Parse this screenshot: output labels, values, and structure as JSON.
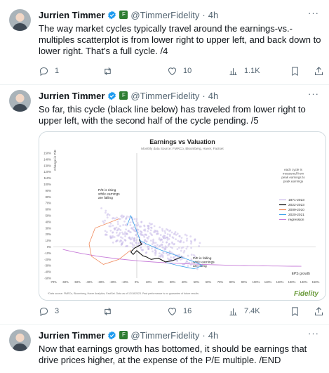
{
  "tweets": [
    {
      "author": "Jurrien Timmer",
      "handle": "@TimmerFidelity",
      "dot": "·",
      "time": "4h",
      "text": "The way market cycles typically travel around the earnings-vs.-multiples scatterplot is from lower right to upper left, and back down to lower right. That's a full cycle. /4",
      "replies": "1",
      "reposts": "",
      "likes": "10",
      "views": "1.1K"
    },
    {
      "author": "Jurrien Timmer",
      "handle": "@TimmerFidelity",
      "dot": "·",
      "time": "4h",
      "text": "So far, this cycle (black line below) has traveled from lower right to upper left, with the second half of the cycle pending. /5",
      "replies": "3",
      "reposts": "",
      "likes": "16",
      "views": "7.4K"
    },
    {
      "author": "Jurrien Timmer",
      "handle": "@TimmerFidelity",
      "dot": "·",
      "time": "4h",
      "text": "Now that earnings growth has bottomed, it should be earnings that drive prices higher, at the expense of the P/E multiple. /END"
    }
  ],
  "chart_data": {
    "type": "scatter",
    "title": "Earnings vs Valuation",
    "subtitle": "Monthly data   Source: FMRCo, Bloomberg, Haver, Factset",
    "ylabel": "Change in P/E",
    "xlabel": "EPS growth",
    "xlim": [
      -70,
      150
    ],
    "ylim": [
      -50,
      100
    ],
    "x_ticks": [
      "-70%",
      "-60%",
      "-50%",
      "-40%",
      "-30%",
      "-20%",
      "-10%",
      "0%",
      "10%",
      "20%",
      "30%",
      "40%",
      "50%",
      "60%",
      "70%",
      "80%",
      "90%",
      "100%",
      "110%",
      "120%",
      "130%",
      "140%",
      "150%"
    ],
    "y_ticks": [
      "150%",
      "140%",
      "130%",
      "120%",
      "110%",
      "100%",
      "90%",
      "80%",
      "70%",
      "60%",
      "50%",
      "40%",
      "30%",
      "20%",
      "10%",
      "0%",
      "-10%",
      "-20%",
      "-30%",
      "-40%",
      "-50%"
    ],
    "note": "each cycle is measured from peak earnings to peak earnings",
    "legend_position": "right",
    "legend": [
      {
        "label": "1871-2023",
        "color": "#c9b8e8"
      },
      {
        "label": "2022-2023",
        "color": "#111111"
      },
      {
        "label": "2009-2010",
        "color": "#f08a5d"
      },
      {
        "label": "2020-2021",
        "color": "#3aa0e8"
      },
      {
        "label": "regression",
        "color": "#c77dd9"
      }
    ],
    "annotations": [
      "P/E is rising while earnings are falling",
      "P/E is falling while earnings are rising"
    ],
    "footnote": "*Data source: FMRCo, Bloomberg, Haver Analytics, FactSet. Data as of 12/18/2023. Past performance is no guarantee of future results.",
    "brand": "Fidelity",
    "series": [
      {
        "name": "2022-2023",
        "x": [
          2,
          4,
          -2,
          -5,
          -3,
          0,
          5,
          8,
          12,
          18,
          24,
          30,
          35,
          38
        ],
        "y": [
          12,
          4,
          -2,
          -8,
          -12,
          -6,
          -14,
          -16,
          -20,
          -18,
          -24,
          -22,
          -18,
          -16
        ]
      },
      {
        "name": "2009-2010",
        "x": [
          -15,
          -35,
          -40,
          -38,
          -28,
          -15,
          -5
        ],
        "y": [
          45,
          30,
          5,
          -15,
          -28,
          -20,
          -5
        ]
      },
      {
        "name": "2020-2021",
        "x": [
          -8,
          -5,
          0,
          3,
          8,
          20,
          35,
          50,
          55,
          48,
          35,
          25
        ],
        "y": [
          35,
          50,
          25,
          10,
          5,
          -5,
          -15,
          -25,
          -30,
          -35,
          -30,
          -25
        ]
      }
    ]
  }
}
